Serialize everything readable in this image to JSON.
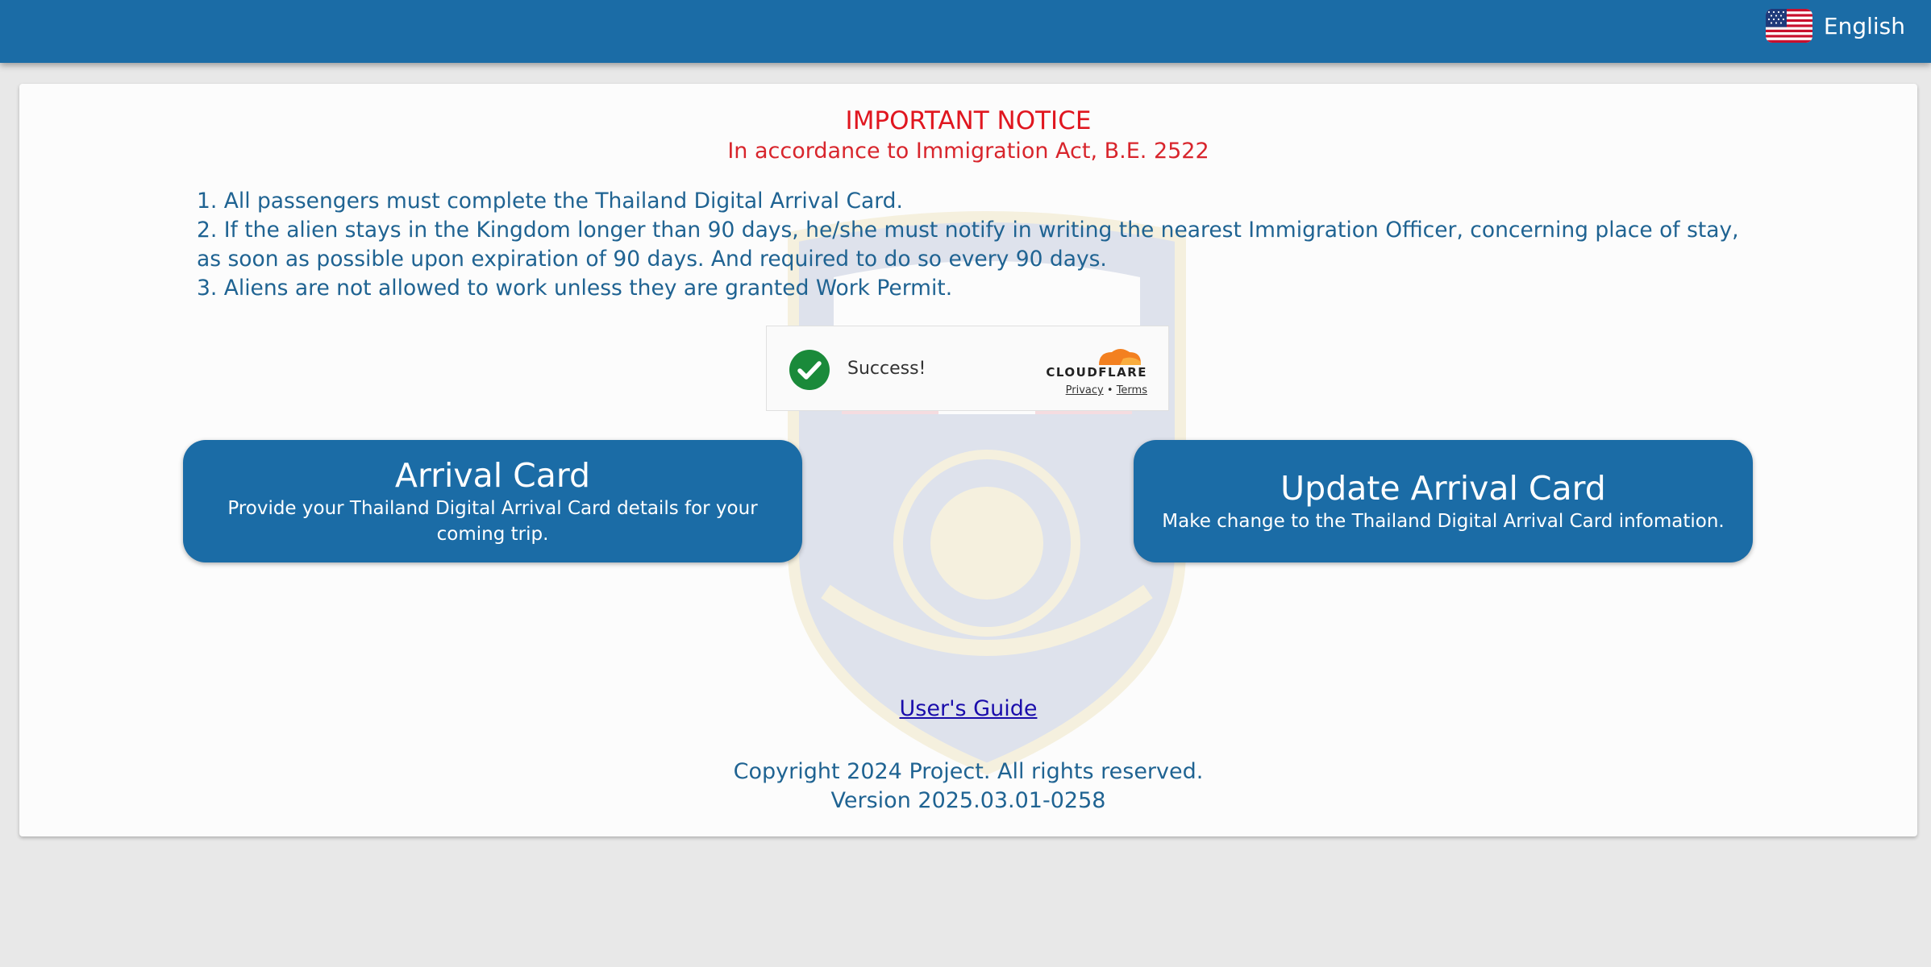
{
  "header": {
    "language_label": "English",
    "language_flag_icon": "us-flag-icon"
  },
  "notice": {
    "title": "IMPORTANT NOTICE",
    "subtitle": "In accordance to Immigration Act, B.E. 2522",
    "rules": [
      "1. All passengers must complete the Thailand Digital Arrival Card.",
      "2. If the alien stays in the Kingdom longer than 90 days, he/she must notify in writing the nearest Immigration Officer, concerning place of stay, as soon as possible upon expiration of 90 days. And required to do so every 90 days.",
      "3. Aliens are not allowed to work unless they are granted Work Permit."
    ]
  },
  "captcha": {
    "status": "Success!",
    "provider": "CLOUDFLARE",
    "privacy_label": "Privacy",
    "separator": "•",
    "terms_label": "Terms"
  },
  "actions": {
    "arrival_card": {
      "title": "Arrival Card",
      "description": "Provide your Thailand Digital Arrival Card details for your coming trip."
    },
    "update_arrival_card": {
      "title": "Update Arrival Card",
      "description": "Make change to the Thailand Digital Arrival Card infomation."
    }
  },
  "footer": {
    "guide_link": "User's Guide",
    "copyright": "Copyright 2024 Project. All rights reserved.",
    "version": "Version 2025.03.01-0258"
  },
  "colors": {
    "brand_blue": "#1b6ca6",
    "notice_red": "#e0161f",
    "text_blue": "#1f6392",
    "success_green": "#1a8a3a",
    "cloudflare_orange": "#f38020"
  }
}
